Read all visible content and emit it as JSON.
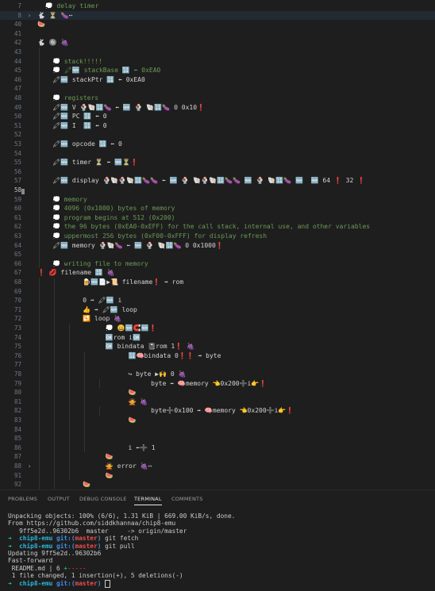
{
  "editor": {
    "lines": [
      {
        "n": "7",
        "fold": "",
        "code": "  💭 delay timer",
        "cls": "cmt",
        "indent": 0
      },
      {
        "n": "8",
        "fold": "›",
        "code": "🐇 ⏳ 🍆⋯",
        "cls": "ident",
        "indent": 0,
        "active": true
      },
      {
        "n": "40",
        "fold": "",
        "code": "🍉",
        "cls": "ident",
        "indent": 0
      },
      {
        "n": "41",
        "fold": "",
        "code": "",
        "cls": "ident",
        "indent": 0
      },
      {
        "n": "42",
        "fold": "",
        "code": "🐇 🔘 🍇",
        "cls": "ident",
        "indent": 0
      },
      {
        "n": "43",
        "fold": "",
        "code": "",
        "cls": "ident",
        "indent": 1
      },
      {
        "n": "44",
        "fold": "",
        "code": "💭 stack!!!!!",
        "cls": "cmt",
        "indent": 1
      },
      {
        "n": "45",
        "fold": "",
        "code": "💭 🖍🆕 stackBase 🔢 ⬅ 0xEA0",
        "cls": "cmt",
        "indent": 1
      },
      {
        "n": "46",
        "fold": "",
        "code": "🖍🆕 stackPtr 🔢 ⬅ 0xEA0",
        "cls": "ident",
        "indent": 1
      },
      {
        "n": "47",
        "fold": "",
        "code": "",
        "cls": "ident",
        "indent": 1
      },
      {
        "n": "48",
        "fold": "",
        "code": "💭 registers",
        "cls": "cmt",
        "indent": 1
      },
      {
        "n": "49",
        "fold": "",
        "code": "🖍🆕 V 🍨🐚🔢🍆 ⬅ 🆕 🍨 🐚🔢🍆 0 0x10❗",
        "cls": "ident",
        "indent": 1
      },
      {
        "n": "50",
        "fold": "",
        "code": "🖍🆕 PC 🔢 ⬅ 0",
        "cls": "ident",
        "indent": 1
      },
      {
        "n": "51",
        "fold": "",
        "code": "🖍🆕 I  🔢 ⬅ 0",
        "cls": "ident",
        "indent": 1
      },
      {
        "n": "52",
        "fold": "",
        "code": "",
        "cls": "ident",
        "indent": 1
      },
      {
        "n": "53",
        "fold": "",
        "code": "🖍🆕 opcode 🔢 ⬅ 0",
        "cls": "ident",
        "indent": 1
      },
      {
        "n": "54",
        "fold": "",
        "code": "",
        "cls": "ident",
        "indent": 1
      },
      {
        "n": "55",
        "fold": "",
        "code": "🖍🆕 timer ⏳ ⬅ 🆕⏳❗",
        "cls": "ident",
        "indent": 1
      },
      {
        "n": "56",
        "fold": "",
        "code": "",
        "cls": "ident",
        "indent": 1
      },
      {
        "n": "57",
        "fold": "",
        "code": "🖍🆕 display 🍨🐚🍨🐚🔢🍆🍆 ⬅ 🆕 🍨 🐚🍨🐚🔢🍆🍆 🆕 🍨 🐚🔢🍆 🆕  🆕 64 ❗ 32 ❗",
        "cls": "ident",
        "indent": 1
      },
      {
        "n": "58",
        "fold": "",
        "code": "",
        "cls": "ident",
        "indent": 1,
        "current": true
      },
      {
        "n": "59",
        "fold": "",
        "code": "💭 memory",
        "cls": "cmt",
        "indent": 1
      },
      {
        "n": "60",
        "fold": "",
        "code": "💭 4096 (0x1000) bytes of memory",
        "cls": "cmt",
        "indent": 1
      },
      {
        "n": "61",
        "fold": "",
        "code": "💭 program begins at 512 (0x200)",
        "cls": "cmt",
        "indent": 1
      },
      {
        "n": "62",
        "fold": "",
        "code": "💭 the 96 bytes (0xEA0-0xEFF) for the call stack, internal use, and other variables",
        "cls": "cmt",
        "indent": 1
      },
      {
        "n": "63",
        "fold": "",
        "code": "💭 uppermost 256 bytes (0xF00-0xFFF) for display refresh",
        "cls": "cmt",
        "indent": 1
      },
      {
        "n": "64",
        "fold": "",
        "code": "🖍🆕 memory 🍨🐚🍆 ⬅ 🆕 🍨 🐚🔢🍆 0 0x1000❗",
        "cls": "ident",
        "indent": 1
      },
      {
        "n": "65",
        "fold": "",
        "code": "",
        "cls": "ident",
        "indent": 1
      },
      {
        "n": "66",
        "fold": "",
        "code": "💭 writing file to memory",
        "cls": "cmt",
        "indent": 1
      },
      {
        "n": "67",
        "fold": "",
        "code": "❗ 💋 filename 🔡 🍇",
        "cls": "ident",
        "indent": 0
      },
      {
        "n": "68",
        "fold": "",
        "code": "    🍺🆕📄▶📜 filename❗ ➡ rom",
        "cls": "ident",
        "indent": 2
      },
      {
        "n": "69",
        "fold": "",
        "code": "",
        "cls": "ident",
        "indent": 2
      },
      {
        "n": "70",
        "fold": "",
        "code": "    0 ➡ 🖍🆕 i",
        "cls": "ident",
        "indent": 2
      },
      {
        "n": "71",
        "fold": "",
        "code": "    👍 ➡ 🖍🆕 loop",
        "cls": "ident",
        "indent": 2
      },
      {
        "n": "72",
        "fold": "",
        "code": "    🔁 loop 🍇",
        "cls": "ident",
        "indent": 2
      },
      {
        "n": "73",
        "fold": "",
        "code": "      💭 😀🆕🧲🆕❗",
        "cls": "ident",
        "indent": 3
      },
      {
        "n": "74",
        "fold": "",
        "code": "      🆗rom i🆗",
        "cls": "ident",
        "indent": 3
      },
      {
        "n": "75",
        "fold": "",
        "code": "      🆗 bindata 📓rom 1❗ 🍇",
        "cls": "ident",
        "indent": 3
      },
      {
        "n": "76",
        "fold": "",
        "code": "        🔢🧠bindata 0❗❗ ➡ byte",
        "cls": "ident",
        "indent": 4
      },
      {
        "n": "77",
        "fold": "",
        "code": "",
        "cls": "ident",
        "indent": 4
      },
      {
        "n": "78",
        "fold": "",
        "code": "        ↪ byte ▶🙌 0 🍇",
        "cls": "ident",
        "indent": 4
      },
      {
        "n": "79",
        "fold": "",
        "code": "          byte ➡ 🧠memory 👈0x200➕i👉❗",
        "cls": "ident",
        "indent": 5
      },
      {
        "n": "80",
        "fold": "",
        "code": "        🍉",
        "cls": "ident",
        "indent": 4
      },
      {
        "n": "81",
        "fold": "",
        "code": "        🙅 🍇",
        "cls": "ident",
        "indent": 4
      },
      {
        "n": "82",
        "fold": "",
        "code": "          byte➕0x100 ➡ 🧠memory 👈0x200➕i👉❗",
        "cls": "ident",
        "indent": 5
      },
      {
        "n": "83",
        "fold": "",
        "code": "        🍉",
        "cls": "ident",
        "indent": 4
      },
      {
        "n": "84",
        "fold": "",
        "code": "",
        "cls": "ident",
        "indent": 4
      },
      {
        "n": "85",
        "fold": "",
        "code": "",
        "cls": "ident",
        "indent": 4
      },
      {
        "n": "86",
        "fold": "",
        "code": "        i ⬅➕ 1",
        "cls": "ident",
        "indent": 4
      },
      {
        "n": "87",
        "fold": "",
        "code": "      🍉",
        "cls": "ident",
        "indent": 3
      },
      {
        "n": "88",
        "fold": "›",
        "code": "      🙅 error 🍇⋯",
        "cls": "ident",
        "indent": 3
      },
      {
        "n": "91",
        "fold": "",
        "code": "      🍉",
        "cls": "ident",
        "indent": 3
      },
      {
        "n": "92",
        "fold": "",
        "code": "    🍉",
        "cls": "ident",
        "indent": 2
      }
    ]
  },
  "panel": {
    "tabs": [
      "PROBLEMS",
      "OUTPUT",
      "DEBUG CONSOLE",
      "TERMINAL",
      "COMMENTS"
    ],
    "active_tab": "TERMINAL"
  },
  "terminal": {
    "l1": "Unpacking objects: 100% (6/6), 1.31 KiB | 669.00 KiB/s, done.",
    "l2": "From https://github.com/siddkhannaa/chip8-emu",
    "l3": "   9ff5e2d..96302b6  master     -> origin/master",
    "prompt_arrow": "➜",
    "prompt_dir": "chip8-emu",
    "prompt_git": "git:(",
    "prompt_branch": "master",
    "prompt_close": ")",
    "cmd1": "git fetch",
    "cmd2": "git pull",
    "l6": "Updating 9ff5e2d..96302b6",
    "l7": "Fast-forward",
    "l8_file": " README.md | 6 ",
    "l8_add": "+",
    "l8_del": "-----",
    "l9": " 1 file changed, 1 insertion(+), 5 deletions(-)"
  }
}
